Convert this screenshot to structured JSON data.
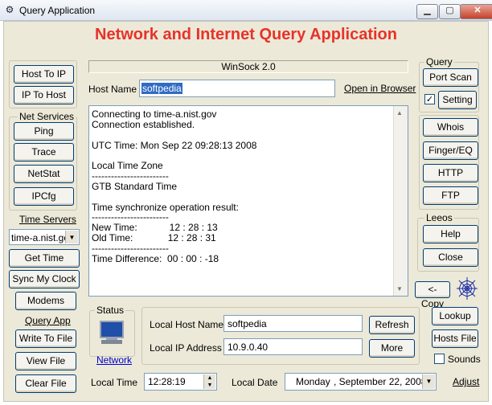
{
  "window": {
    "title": "Query Application"
  },
  "heading": "Network and Internet Query Application",
  "left": {
    "host_to_ip": "Host To IP",
    "ip_to_host": "IP To Host",
    "net_services_label": "Net Services",
    "ping": "Ping",
    "trace": "Trace",
    "netstat": "NetStat",
    "ipcfg": "IPCfg",
    "time_servers_label": "Time Servers",
    "time_server_selected": "time-a.nist.gov",
    "get_time": "Get Time",
    "sync_clock": "Sync My Clock",
    "modems": "Modems",
    "query_app_label": "Query App",
    "write_to_file": "Write To File",
    "view_file": "View File",
    "clear_file": "Clear File"
  },
  "center": {
    "winsock": "WinSock 2.0",
    "host_name_label": "Host Name",
    "host_name_value": "softpedia",
    "open_in_browser": "Open in Browser",
    "output_lines": [
      "Connecting to time-a.nist.gov",
      "Connection established.",
      "",
      "UTC Time: Mon Sep 22 09:28:13 2008",
      "",
      "Local Time Zone",
      "------------------------",
      "GTB Standard Time",
      "",
      "Time synchronize operation result:",
      "------------------------",
      "New Time:            12 : 28 : 13",
      "Old Time:             12 : 28 : 31",
      "------------------------",
      "Time Difference:  00 : 00 : -18"
    ]
  },
  "status": {
    "label": "Status",
    "network_link": "Network",
    "local_host_label": "Local Host Name",
    "local_host_value": "softpedia",
    "local_ip_label": "Local IP Address",
    "local_ip_value": "10.9.0.40",
    "refresh": "Refresh",
    "more": "More"
  },
  "bottom": {
    "local_time_label": "Local Time",
    "local_time_value": "12:28:19",
    "local_date_label": "Local Date",
    "local_date_day": "Monday",
    "local_date_value": ", September 22, 2008",
    "adjust": "Adjust"
  },
  "right": {
    "query_label": "Query",
    "port_scan": "Port Scan",
    "setting": "Setting",
    "setting_checked": true,
    "whois": "Whois",
    "finger": "Finger/EQ",
    "http": "HTTP",
    "ftp": "FTP",
    "leeos_label": "Leeos",
    "help": "Help",
    "close": "Close",
    "copy": "<- Copy",
    "lookup": "Lookup",
    "hosts_file": "Hosts File",
    "sounds": "Sounds",
    "sounds_checked": false
  },
  "colors": {
    "heading": "#e8322a",
    "panel": "#ece9d8",
    "link": "#0000cc"
  }
}
